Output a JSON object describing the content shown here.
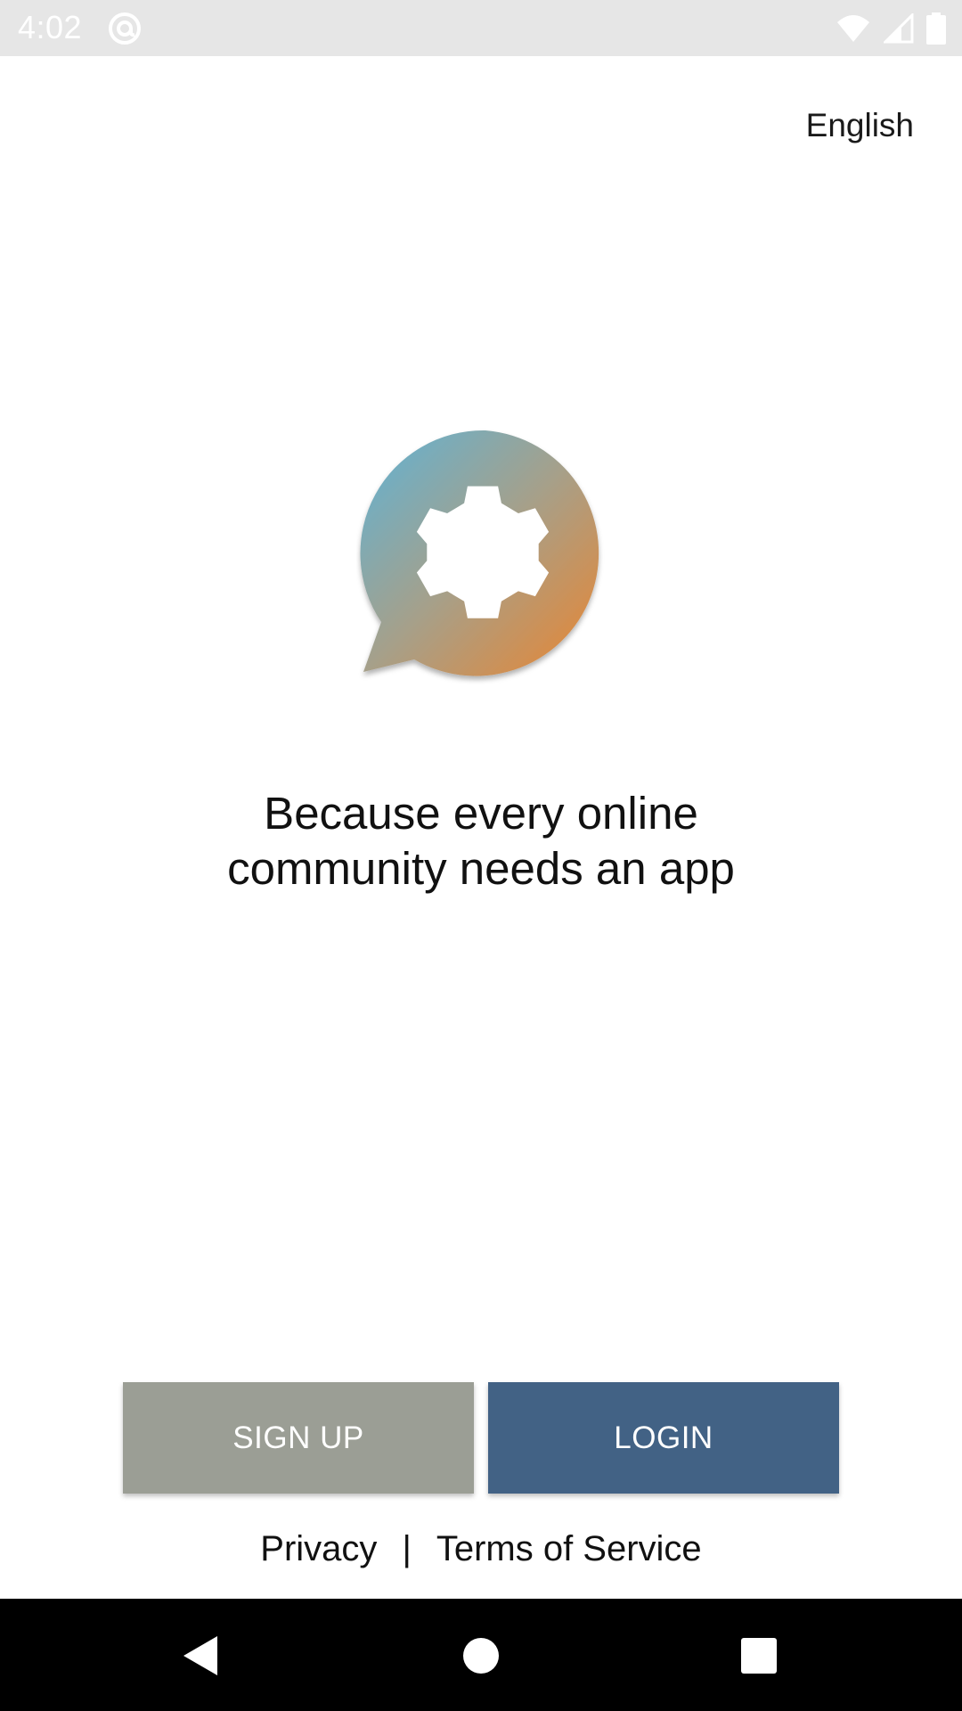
{
  "status_bar": {
    "time": "4:02",
    "icons": [
      "at-sign-icon",
      "wifi-icon",
      "cellular-signal-icon",
      "battery-icon"
    ]
  },
  "language_selector": {
    "label": "English"
  },
  "logo": {
    "icon": "chat-bubble-gear-logo",
    "colors": [
      "#6ab2cf",
      "#a6a08a",
      "#de8a3a"
    ]
  },
  "tagline": {
    "line1": "Because every online",
    "line2": "community needs an app"
  },
  "buttons": {
    "signup_label": "SIGN UP",
    "login_label": "LOGIN",
    "signup_color": "#9b9e95",
    "login_color": "#426285"
  },
  "footer": {
    "privacy": "Privacy",
    "separator": "|",
    "terms": "Terms of Service"
  },
  "nav_bar": {
    "icons": [
      "back-icon",
      "home-icon",
      "recents-icon"
    ]
  }
}
